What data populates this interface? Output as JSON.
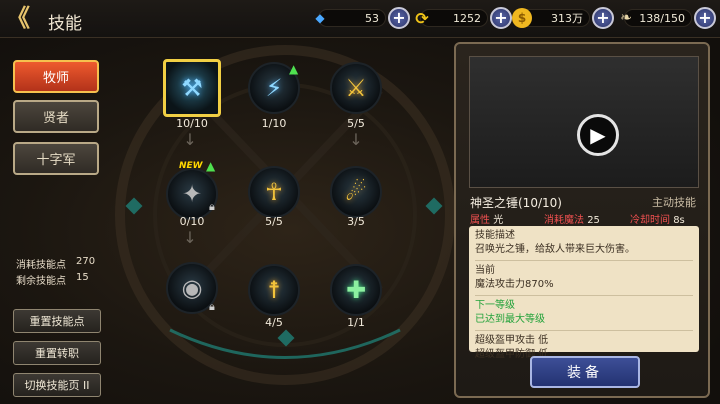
{
  "header": {
    "back_icon": "back-arrow-icon",
    "title": "技能"
  },
  "resources": [
    {
      "icon": "gem-icon",
      "value": "53",
      "color": "#4aa8ff"
    },
    {
      "icon": "swirl-icon",
      "value": "1252",
      "color": "#f0c419"
    },
    {
      "icon": "gold-coin-icon",
      "value": "313万",
      "color": "#f0b820"
    },
    {
      "icon": "wing-icon",
      "value": "138/150",
      "color": "#e8d6a8"
    }
  ],
  "class_tabs": [
    {
      "label": "牧师",
      "active": true
    },
    {
      "label": "贤者",
      "active": false
    },
    {
      "label": "十字军",
      "active": false
    }
  ],
  "skill_points": {
    "consumed_label": "消耗技能点",
    "consumed_value": "270",
    "remaining_label": "剩余技能点",
    "remaining_value": "15"
  },
  "side_buttons": {
    "reset_skill": "重置技能点",
    "reset_job": "重置转职",
    "switch_page": "切换技能页 II"
  },
  "skills": [
    {
      "level": "10/10",
      "icon": "holy-hammer-icon",
      "selected": true
    },
    {
      "level": "1/10",
      "icon": "lightning-icon",
      "upgradable": true
    },
    {
      "level": "5/5",
      "icon": "holy-sword-icon"
    },
    {
      "level": "0/10",
      "icon": "summon-icon",
      "new": "NEW",
      "locked": true,
      "upgradable": true
    },
    {
      "level": "5/5",
      "icon": "shield-icon"
    },
    {
      "level": "3/5",
      "icon": "strike-icon"
    },
    {
      "level": "",
      "icon": "eye-icon",
      "locked": true
    },
    {
      "level": "4/5",
      "icon": "pillar-icon"
    },
    {
      "level": "1/1",
      "icon": "heal-icon"
    }
  ],
  "detail": {
    "play_icon": "play-icon",
    "name": "神圣之锤(10/10)",
    "type": "主动技能",
    "attr_label": "属性",
    "attr_value": "光",
    "mana_label": "消耗魔法",
    "mana_value": "25",
    "cd_label": "冷却时间",
    "cd_value": "8s",
    "desc_title": "技能描述",
    "desc_text": "召唤光之锤，给敌人带来巨大伤害。",
    "current_label": "当前",
    "current_value": "魔法攻击力870%",
    "next_label": "下一等级",
    "next_value": "已达到最大等级",
    "extra1": "超级盔甲攻击  低",
    "extra2": "超级盔甲防御  低",
    "equip_label": "装备"
  }
}
